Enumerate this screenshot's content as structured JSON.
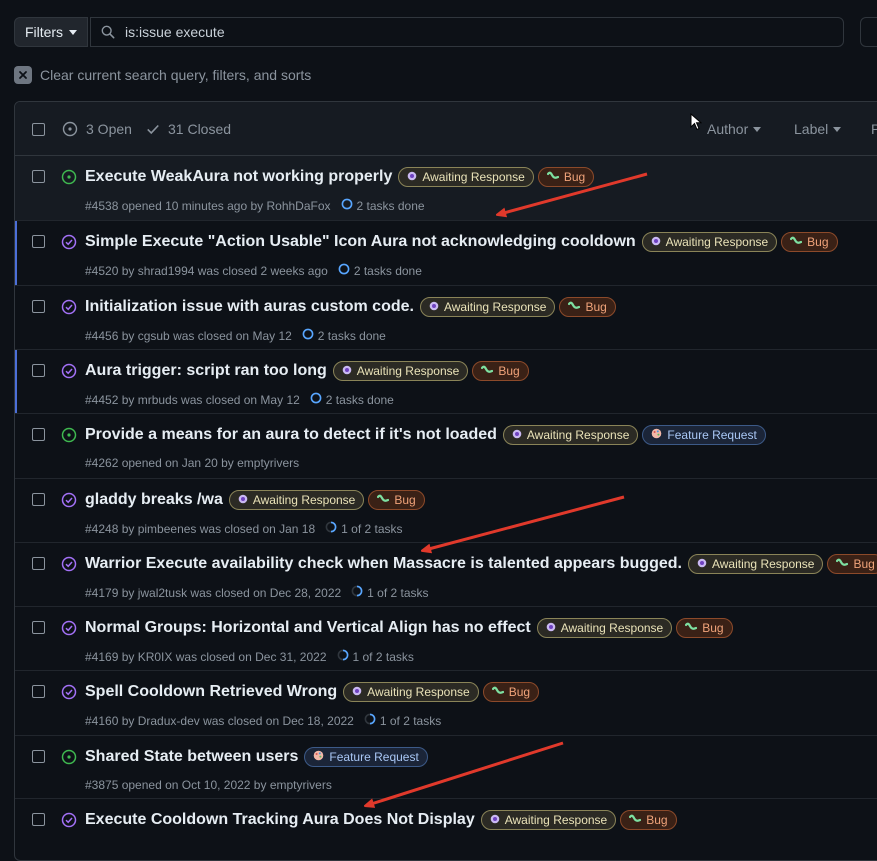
{
  "toolbar": {
    "filters_label": "Filters",
    "search_value": "is:issue execute",
    "clear_label": "Clear current search query, filters, and sorts"
  },
  "header": {
    "open_label": "3 Open",
    "closed_label": "31 Closed",
    "author_label": "Author",
    "label_label": "Label",
    "more_label": "P"
  },
  "labels": {
    "awaiting": "Awaiting Response",
    "bug": "Bug",
    "feature": "Feature Request"
  },
  "colors": {
    "open_icon": "#3fb950",
    "closed_icon": "#a371f7",
    "task_icon": "#58a6ff",
    "arrow": "#e0392b",
    "row_bar": "#4c6fd8"
  },
  "issues": [
    {
      "title": "Execute WeakAura not working properly",
      "state": "open",
      "labels": [
        "awaiting",
        "bug"
      ],
      "meta": "#4538 opened 10 minutes ago by RohhDaFox",
      "tasks": "2 tasks done"
    },
    {
      "title": "Simple Execute \"Action Usable\" Icon Aura not acknowledging cooldown",
      "state": "closed",
      "labels": [
        "awaiting",
        "bug"
      ],
      "meta": "#4520 by shrad1994 was closed 2 weeks ago",
      "tasks": "2 tasks done"
    },
    {
      "title": "Initialization issue with auras custom code.",
      "state": "closed",
      "labels": [
        "awaiting",
        "bug"
      ],
      "meta": "#4456 by cgsub was closed on May 12",
      "tasks": "2 tasks done"
    },
    {
      "title": "Aura trigger: script ran too long",
      "state": "closed",
      "labels": [
        "awaiting",
        "bug"
      ],
      "meta": "#4452 by mrbuds was closed on May 12",
      "tasks": "2 tasks done"
    },
    {
      "title": "Provide a means for an aura to detect if it's not loaded",
      "state": "open",
      "labels": [
        "awaiting",
        "feature"
      ],
      "meta": "#4262 opened on Jan 20 by emptyrivers",
      "tasks": ""
    },
    {
      "title": "gladdy breaks /wa",
      "state": "closed",
      "labels": [
        "awaiting",
        "bug"
      ],
      "meta": "#4248 by pimbeenes was closed on Jan 18",
      "tasks": "1 of 2 tasks"
    },
    {
      "title": "Warrior Execute availability check when Massacre is talented appears bugged.",
      "state": "closed",
      "labels": [
        "awaiting",
        "bug"
      ],
      "meta": "#4179 by jwal2tusk was closed on Dec 28, 2022",
      "tasks": "1 of 2 tasks"
    },
    {
      "title": "Normal Groups: Horizontal and Vertical Align has no effect",
      "state": "closed",
      "labels": [
        "awaiting",
        "bug"
      ],
      "meta": "#4169 by KR0IX was closed on Dec 31, 2022",
      "tasks": "1 of 2 tasks"
    },
    {
      "title": "Spell Cooldown Retrieved Wrong",
      "state": "closed",
      "labels": [
        "awaiting",
        "bug"
      ],
      "meta": "#4160 by Dradux-dev was closed on Dec 18, 2022",
      "tasks": "1 of 2 tasks"
    },
    {
      "title": "Shared State between users",
      "state": "open",
      "labels": [
        "feature"
      ],
      "meta": "#3875 opened on Oct 10, 2022 by emptyrivers",
      "tasks": ""
    },
    {
      "title": "Execute Cooldown Tracking Aura Does Not Display",
      "state": "closed",
      "labels": [
        "awaiting",
        "bug"
      ],
      "meta": "",
      "tasks": ""
    }
  ]
}
